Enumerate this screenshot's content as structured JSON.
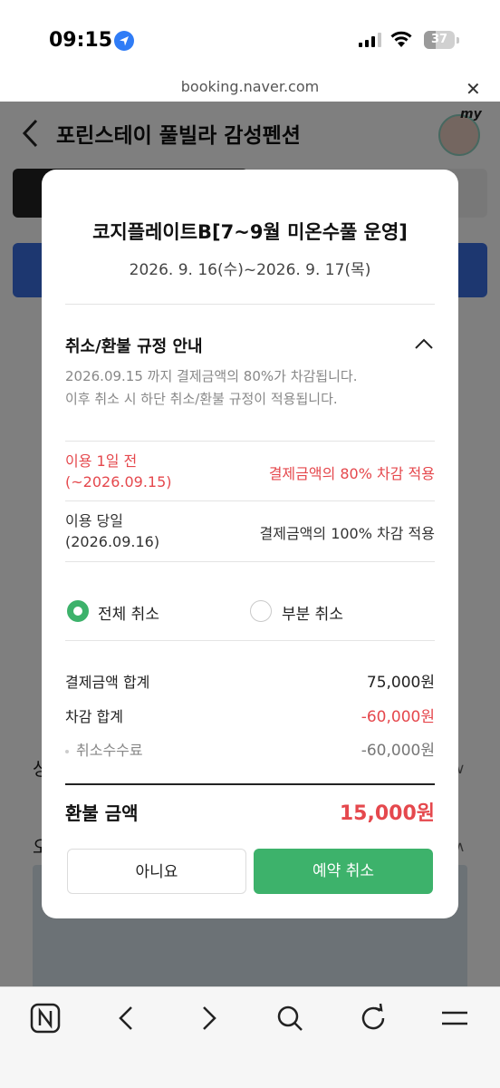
{
  "status": {
    "time": "09:15",
    "battery": "37",
    "battery_level": 0.37
  },
  "browser": {
    "url": "booking.naver.com"
  },
  "page": {
    "title": "포린스테이 풀빌라 감성펜션",
    "avatar_tag": "my"
  },
  "modal": {
    "title": "코지플레이트B[7~9월 미온수풀 운영]",
    "dates": "2026. 9. 16(수)~2026. 9. 17(목)",
    "section_title": "취소/환불 규정 안내",
    "notice_line1": "2026.09.15 까지 결제금액의 80%가 차감됩니다.",
    "notice_line2": "이후 취소 시 하단 취소/환불 규정이 적용됩니다.",
    "rules": [
      {
        "label_line1": "이용 1일 전",
        "label_line2": "(~2026.09.15)",
        "value": "결제금액의 80% 차감 적용"
      },
      {
        "label_line1": "이용 당일",
        "label_line2": "(2026.09.16)",
        "value": "결제금액의 100% 차감 적용"
      }
    ],
    "cancel_options": {
      "full": "전체 취소",
      "partial": "부분 취소",
      "selected": "full"
    },
    "summary": {
      "total_label": "결제금액 합계",
      "total_value": "75,000원",
      "deduction_label": "차감 합계",
      "deduction_value": "-60,000원",
      "fee_label": "취소수수료",
      "fee_value": "-60,000원"
    },
    "refund": {
      "label": "환불 금액",
      "value": "15,000원"
    },
    "buttons": {
      "no": "아니요",
      "confirm": "예약 취소"
    }
  }
}
